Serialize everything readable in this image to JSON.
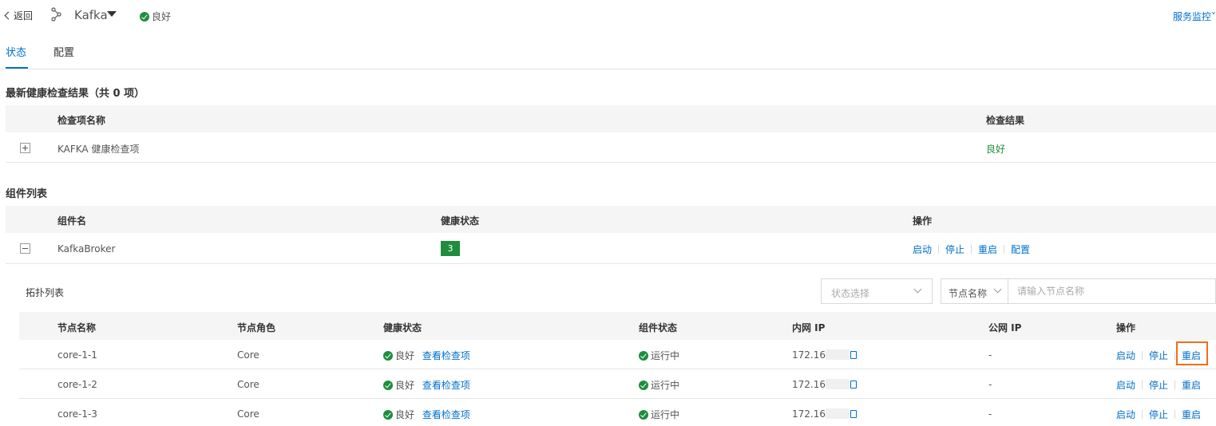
{
  "header": {
    "back_label": "返回",
    "service_name": "Kafka",
    "service_status": "良好",
    "monitor_label": "服务监控"
  },
  "tabs": [
    {
      "label": "状态",
      "active": true
    },
    {
      "label": "配置",
      "active": false
    }
  ],
  "health_check": {
    "title": "最新健康检查结果（共 0 项）",
    "columns": [
      "检查项名称",
      "检查结果"
    ],
    "rows": [
      {
        "name": "KAFKA 健康检查项",
        "result": "良好"
      }
    ]
  },
  "components": {
    "title": "组件列表",
    "columns": [
      "组件名",
      "健康状态",
      "操作"
    ],
    "rows": [
      {
        "name": "KafkaBroker",
        "health_count": "3",
        "actions": [
          "启动",
          "停止",
          "重启",
          "配置"
        ]
      }
    ]
  },
  "topology": {
    "title": "拓扑列表",
    "status_filter_placeholder": "状态选择",
    "node_filter_label": "节点名称",
    "node_search_placeholder": "请输入节点名称",
    "columns": [
      "节点名称",
      "节点角色",
      "健康状态",
      "组件状态",
      "内网 IP",
      "公网 IP",
      "操作"
    ],
    "rows": [
      {
        "node": "core-1-1",
        "role": "Core",
        "health": "良好",
        "health_link": "查看检查项",
        "status": "运行中",
        "private_ip": "172.16",
        "public_ip": "-",
        "actions": [
          "启动",
          "停止",
          "重启"
        ]
      },
      {
        "node": "core-1-2",
        "role": "Core",
        "health": "良好",
        "health_link": "查看检查项",
        "status": "运行中",
        "private_ip": "172.16",
        "public_ip": "-",
        "actions": [
          "启动",
          "停止",
          "重启"
        ]
      },
      {
        "node": "core-1-3",
        "role": "Core",
        "health": "良好",
        "health_link": "查看检查项",
        "status": "运行中",
        "private_ip": "172.16",
        "public_ip": "-",
        "actions": [
          "启动",
          "停止",
          "重启"
        ]
      }
    ]
  },
  "colors": {
    "primary": "#0070cc",
    "success": "#1e8e3e",
    "highlight": "#f06d1f"
  }
}
